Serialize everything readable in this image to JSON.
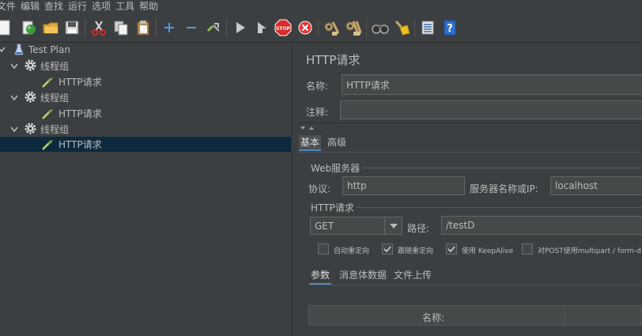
{
  "menu": [
    "文件",
    "编辑",
    "查找",
    "运行",
    "选项",
    "工具",
    "帮助"
  ],
  "toolbar": {
    "icons": [
      "new-icon",
      "templates-icon",
      "open-icon",
      "save-icon",
      "cut-icon",
      "copy-icon",
      "paste-icon",
      "expand-icon",
      "collapse-icon",
      "toggle-icon",
      "start-icon",
      "start-no-pause-icon",
      "stop-icon",
      "shutdown-icon",
      "clear-icon",
      "clear-all-icon",
      "search-icon",
      "reset-search-icon",
      "function-helper-icon",
      "help-icon"
    ]
  },
  "tree": {
    "root": "Test Plan",
    "groups": [
      {
        "label": "线程组",
        "child": "HTTP请求"
      },
      {
        "label": "线程组",
        "child": "HTTP请求"
      },
      {
        "label": "线程组",
        "child": "HTTP请求"
      }
    ]
  },
  "panel": {
    "title": "HTTP请求",
    "name_label": "名称:",
    "name_value": "HTTP请求",
    "comment_label": "注释:",
    "comment_value": "",
    "tabs": [
      "基本",
      "高级"
    ],
    "web_server": {
      "title": "Web服务器",
      "protocol_label": "协议:",
      "protocol_value": "http",
      "server_label": "服务器名称或IP:",
      "server_value": "localhost"
    },
    "http_request": {
      "title": "HTTP请求",
      "method": "GET",
      "path_label": "路径:",
      "path_value": "/testD",
      "options": [
        {
          "label": "自动重定向",
          "checked": false
        },
        {
          "label": "跟随重定向",
          "checked": true
        },
        {
          "label": "使用 KeepAlive",
          "checked": true
        },
        {
          "label": "对POST使用multipart / form-d",
          "checked": false
        }
      ]
    },
    "subtabs": [
      "参数",
      "消息体数据",
      "文件上传"
    ],
    "table": {
      "column_name": "名称:"
    }
  }
}
